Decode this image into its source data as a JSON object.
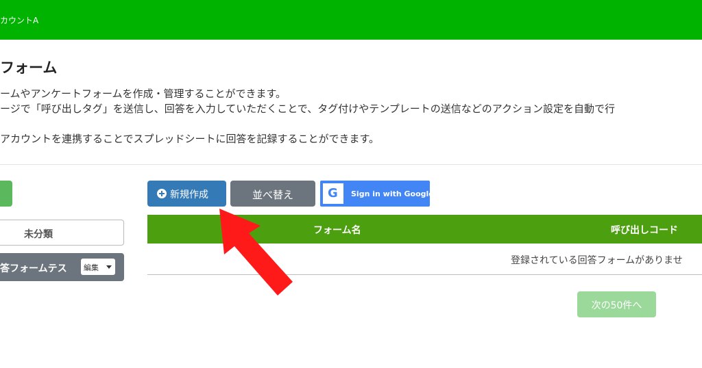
{
  "header": {
    "account_name": "カウントA"
  },
  "page": {
    "title": "フォーム",
    "description_lines": [
      "ームやアンケートフォームを作成・管理することができます。",
      "ージで「呼び出しタグ」を送信し、回答を入力していただくことで、タグ付けやテンプレートの送信などのアクション設定を自動で行",
      "アカウントを連携することでスプレッドシートに回答を記録することができます。"
    ]
  },
  "sidebar": {
    "categories": [
      {
        "label": "未分類"
      },
      {
        "label": "答フォームテス",
        "edit_label": "編集"
      }
    ]
  },
  "toolbar": {
    "new_label": "新規作成",
    "sort_label": "並べ替え",
    "google_label": "Sign in with Google",
    "google_letter": "G"
  },
  "table": {
    "columns": [
      "フォーム名",
      "呼び出しコード"
    ],
    "empty_message": "登録されている回答フォームがありませ"
  },
  "pagination": {
    "next_label": "次の50件へ"
  },
  "colors": {
    "header_bar": "#00b300",
    "table_header": "#4c9f0e",
    "primary_button": "#337ab7",
    "secondary_button": "#6c757d",
    "google_blue": "#4285f4",
    "next_button_disabled": "#9bd99b",
    "annotation_arrow": "#ff1a1a"
  }
}
